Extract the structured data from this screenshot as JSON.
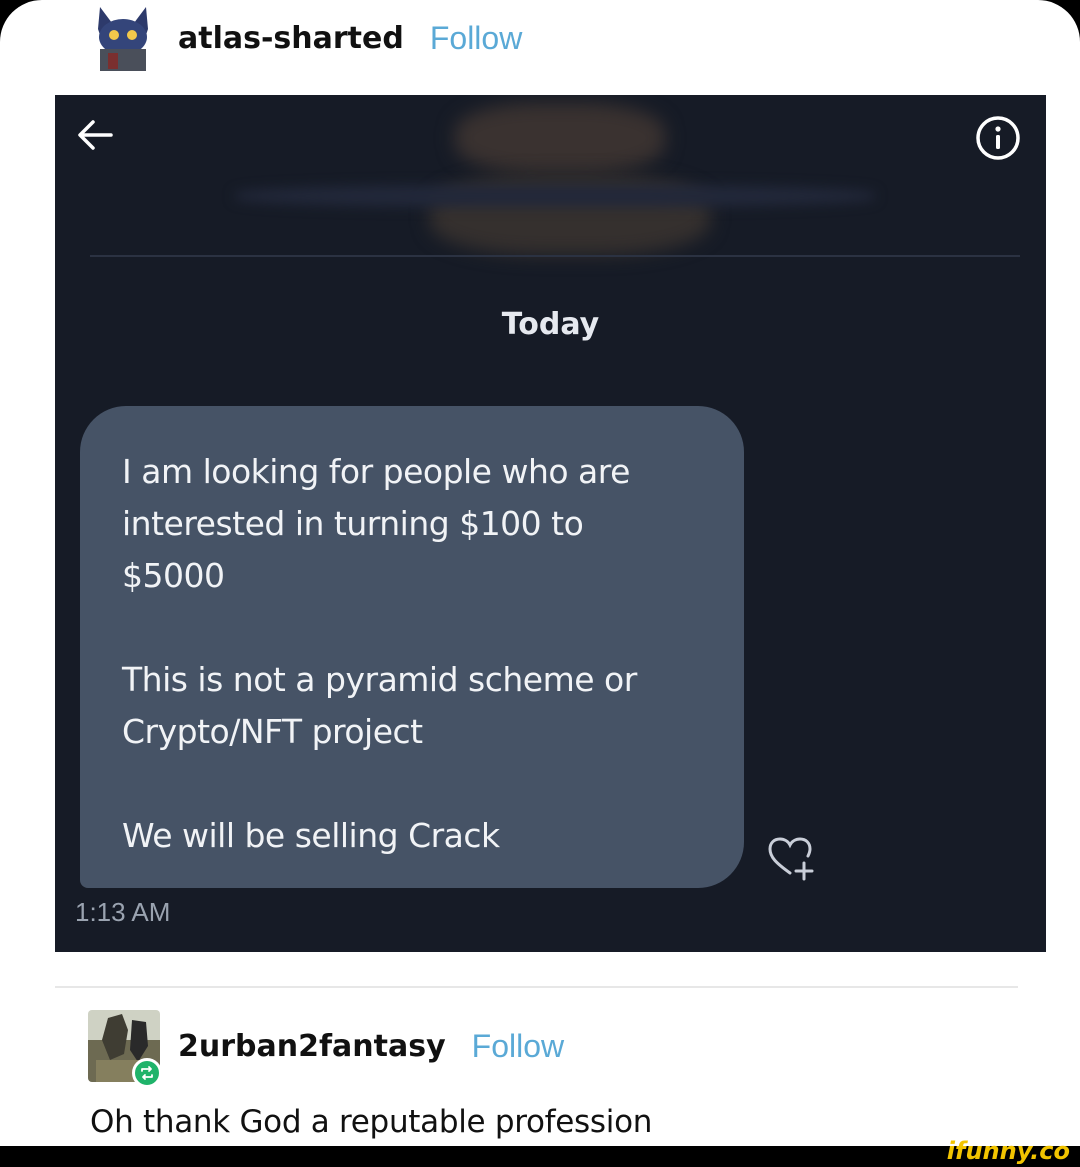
{
  "post": {
    "username": "atlas-sharted",
    "follow_label": "Follow"
  },
  "dm": {
    "day_label": "Today",
    "message_paragraphs": [
      "I am looking for people who are\ninterested in turning $100 to\n$5000",
      "This is not a pyramid scheme or\nCrypto/NFT project",
      "We will be selling Crack"
    ],
    "timestamp": "1:13 AM",
    "colors": {
      "panel_bg": "#161b26",
      "bubble_bg": "#465366"
    },
    "icons": [
      "back-arrow-icon",
      "info-icon",
      "heart-add-icon"
    ]
  },
  "reblog": {
    "username": "2urban2fantasy",
    "follow_label": "Follow",
    "comment": "Oh thank God a reputable profession"
  },
  "watermark": "ifunny.co",
  "colors": {
    "follow_link": "#5aa9d6",
    "reblog_badge": "#1fb36a"
  }
}
